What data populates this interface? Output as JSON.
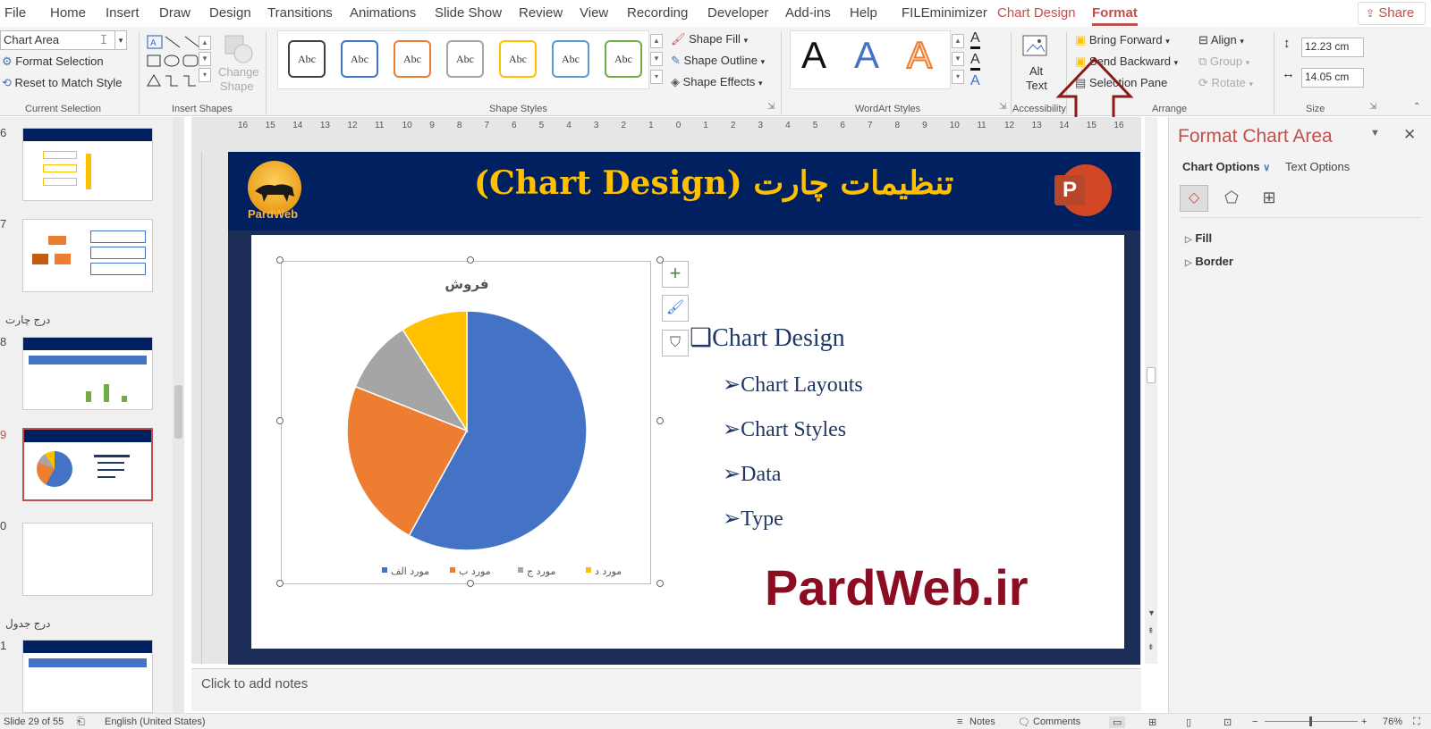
{
  "menu": {
    "tabs": [
      "File",
      "Home",
      "Insert",
      "Draw",
      "Design",
      "Transitions",
      "Animations",
      "Slide Show",
      "Review",
      "View",
      "Recording",
      "Developer",
      "Add-ins",
      "Help",
      "FILEminimizer"
    ],
    "contextual_tab": "Chart Design",
    "active_tab": "Format",
    "share_label": "Share"
  },
  "ribbon": {
    "current_selection": {
      "combo_value": "Chart Area",
      "format_selection": "Format Selection",
      "reset_style": "Reset to Match Style",
      "label": "Current Selection"
    },
    "insert_shapes": {
      "change_shape": "Change",
      "change_shape2": "Shape",
      "label": "Insert Shapes"
    },
    "shape_styles": {
      "swatch_text": "Abc",
      "swatch_colors": [
        "#404040",
        "#4472c4",
        "#ed7d31",
        "#a5a5a5",
        "#ffc000",
        "#5b9bd5",
        "#70ad47"
      ],
      "shape_fill": "Shape Fill",
      "shape_outline": "Shape Outline",
      "shape_effects": "Shape Effects",
      "label": "Shape Styles"
    },
    "wordart": {
      "letter": "A",
      "label": "WordArt Styles"
    },
    "accessibility": {
      "alt_text_1": "Alt",
      "alt_text_2": "Text",
      "label": "Accessibility"
    },
    "arrange": {
      "bring_forward": "Bring Forward",
      "send_backward": "Send Backward",
      "selection_pane": "Selection Pane",
      "align": "Align",
      "group": "Group",
      "rotate": "Rotate",
      "label": "Arrange"
    },
    "size": {
      "height": "12.23 cm",
      "width": "14.05 cm",
      "label": "Size"
    }
  },
  "ruler": {
    "numbers": [
      "16",
      "15",
      "14",
      "13",
      "12",
      "11",
      "10",
      "9",
      "8",
      "7",
      "6",
      "5",
      "4",
      "3",
      "2",
      "1",
      "0",
      "1",
      "2",
      "3",
      "4",
      "5",
      "6",
      "7",
      "8",
      "9",
      "10",
      "11",
      "12",
      "13",
      "14",
      "15",
      "16"
    ]
  },
  "thumbnails": {
    "slides": [
      {
        "num": "6",
        "selected": false
      },
      {
        "num": "7",
        "selected": false
      },
      {
        "num": "8",
        "selected": false
      },
      {
        "num": "9",
        "selected": true
      },
      {
        "num": "0",
        "selected": false
      },
      {
        "num": "1",
        "selected": false
      }
    ],
    "section_insert_chart": "درج چارت",
    "section_insert_table": "درج جدول"
  },
  "slide": {
    "logo_text": "PardWeb",
    "title": "تنظیمات چارت (Chart Design)",
    "bullets": {
      "main": "Chart Design",
      "subs": [
        "Chart Layouts",
        "Chart Styles",
        "Data",
        "Type"
      ]
    },
    "watermark": "PardWeb.ir",
    "ppt_logo_letter": "P"
  },
  "chart_data": {
    "type": "pie",
    "title": "فروش",
    "categories": [
      "مورد الف",
      "مورد ب",
      "مورد ج",
      "مورد د"
    ],
    "values": [
      58,
      23,
      10,
      9
    ],
    "colors": [
      "#4472c4",
      "#ed7d31",
      "#a5a5a5",
      "#ffc000"
    ],
    "legend_position": "bottom"
  },
  "notes_placeholder": "Click to add notes",
  "format_pane": {
    "title": "Format Chart Area",
    "tab_chart_options": "Chart Options",
    "tab_text_options": "Text Options",
    "sections": [
      "Fill",
      "Border"
    ]
  },
  "status_bar": {
    "slide_counter": "Slide 29 of 55",
    "language": "English (United States)",
    "notes": "Notes",
    "comments": "Comments",
    "zoom": "76%"
  }
}
